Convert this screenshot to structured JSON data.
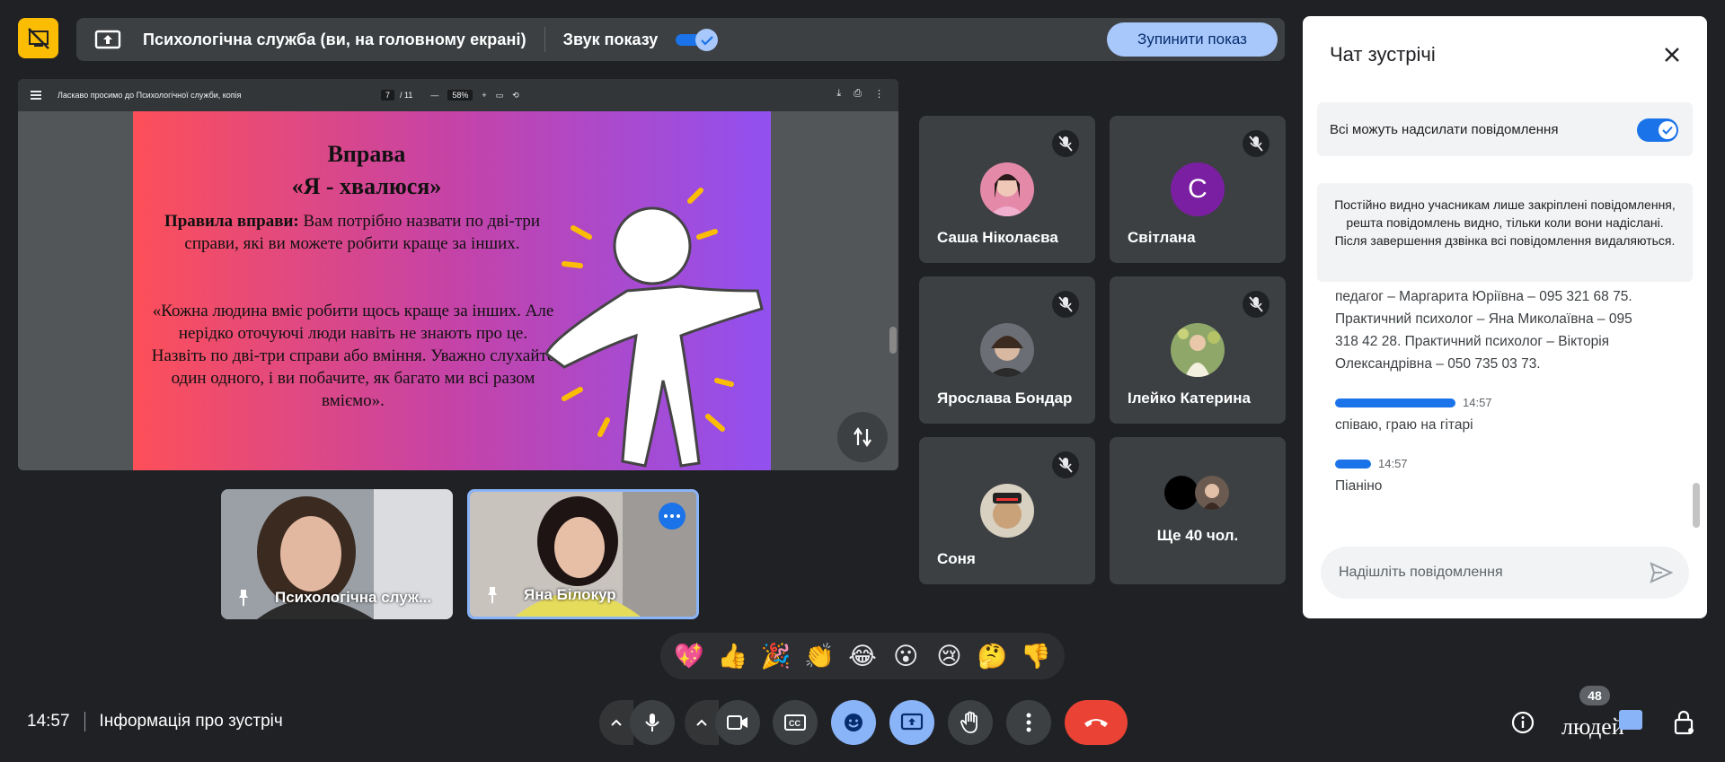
{
  "presenting": {
    "title": "Психологічна служба (ви, на головному екрані)",
    "sound_label": "Звук показу",
    "sound_on": true,
    "stop_label": "Зупинити показ"
  },
  "pdf": {
    "doc_title": "Ласкаво просимо до Психологічної служби, копія",
    "page_current": "7",
    "page_total": "/ 11",
    "zoom": "58%",
    "minus": "—",
    "plus": "+"
  },
  "slide": {
    "title_line1": "Вправа",
    "title_line2": "«Я - хвалюся»",
    "rules_bold": "Правила вправи:",
    "rules_text": " Вам потрібно назвати по дві-три справи, які ви можете робити краще за інших.",
    "quote": "«Кожна людина вміє робити щось краще за інших. Але нерідко оточуючі люди навіть не знають про це. Назвіть по дві-три справи або вміння. Уважно слухайте один одного, і ви побачите, як багато ми всі разом вміємо»."
  },
  "self_tiles": [
    {
      "name": "Психологічна служ..."
    },
    {
      "name": "Яна Білокур"
    }
  ],
  "participants": [
    {
      "name": "Саша Ніколаєва",
      "avatar": "photo"
    },
    {
      "name": "Світлана",
      "initial": "С",
      "avatar_color": "#7b1fa2"
    },
    {
      "name": "Ярослава Бондар",
      "avatar": "photo"
    },
    {
      "name": "Ілейко Катерина",
      "avatar": "photo"
    },
    {
      "name": "Соня",
      "avatar": "photo"
    },
    {
      "name": "Ще 40 чол.",
      "avatar": "group"
    }
  ],
  "chat": {
    "title": "Чат зустрічі",
    "allow_label": "Всі можуть надсилати повідомлення",
    "notice": "Постійно видно учасникам лише закріплені повідомлення, решта повідомлень видно, тільки коли вони надіслані. Після завершення дзвінка всі повідомлення видаляються.",
    "msg1_line1": "педагог – Маргарита Юріївна – 095 321 68 75.",
    "msg1_line2": "Практичний психолог – Яна Миколаївна – 095",
    "msg1_line3": "318 42 28. Практичний психолог – Вікторія",
    "msg1_line4": "Олександрівна – 050 735 03 73.",
    "msg2_time": "14:57",
    "msg2_text": "співаю, граю на гітарі",
    "msg3_time": "14:57",
    "msg3_text": "Піаніно",
    "input_placeholder": "Надішліть повідомлення"
  },
  "reactions": [
    "💖",
    "👍",
    "🎉",
    "👏",
    "😂",
    "😮",
    "😢",
    "🤔",
    "👎"
  ],
  "bottom": {
    "time": "14:57",
    "meeting_info": "Інформація про зустріч",
    "people_count": "48",
    "people_label": "людей"
  },
  "colors": {
    "accent": "#8ab4f8",
    "end_call": "#ea4335",
    "present_logo": "#fbbc04"
  }
}
